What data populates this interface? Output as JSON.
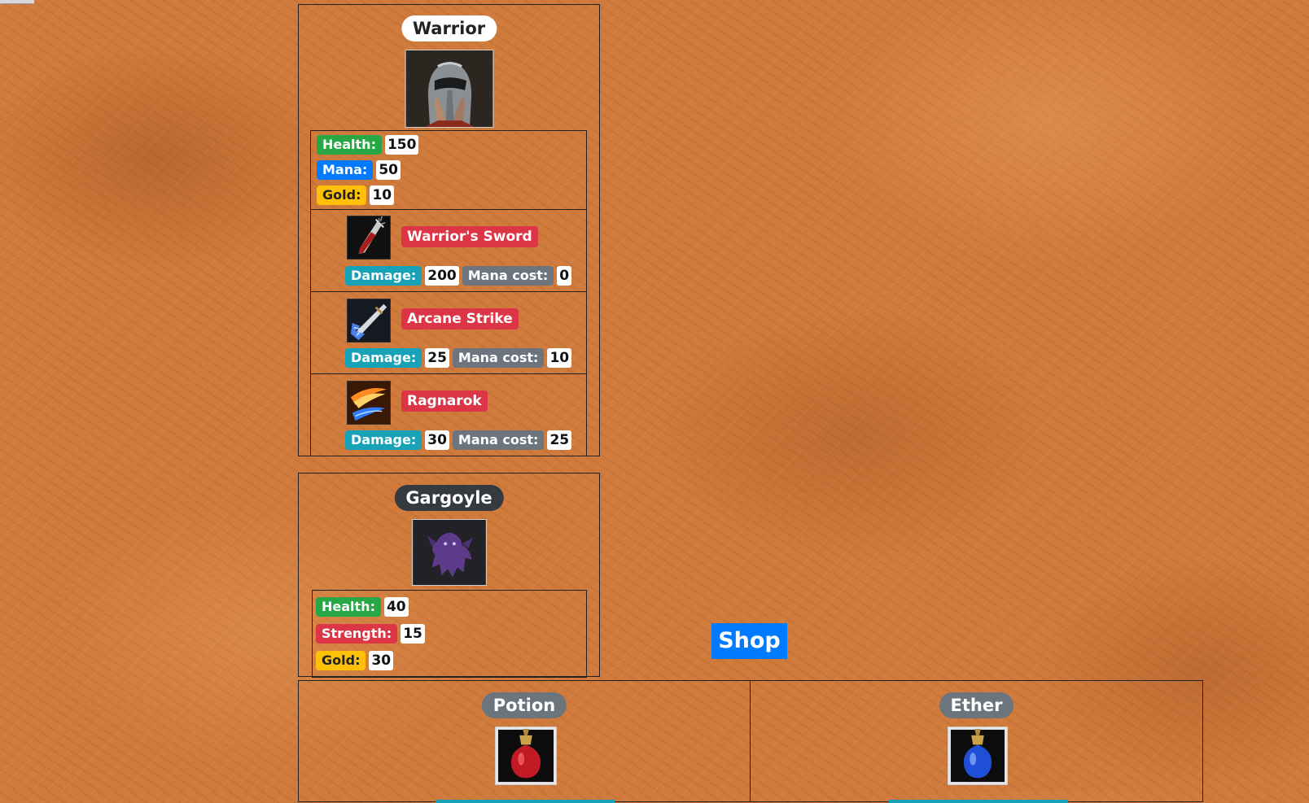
{
  "hero": {
    "name": "Warrior",
    "portrait_icon": "warrior-helmet-portrait",
    "stats": {
      "health_label": "Health:",
      "health": "150",
      "mana_label": "Mana:",
      "mana": "50",
      "gold_label": "Gold:",
      "gold": "10"
    },
    "skills": [
      {
        "name": "Warrior's Sword",
        "icon": "bloody-sword-icon",
        "damage_label": "Damage:",
        "damage": "200",
        "mana_cost_label": "Mana cost:",
        "mana_cost": "0"
      },
      {
        "name": "Arcane Strike",
        "icon": "lightning-blade-icon",
        "damage_label": "Damage:",
        "damage": "25",
        "mana_cost_label": "Mana cost:",
        "mana_cost": "10"
      },
      {
        "name": "Ragnarok",
        "icon": "fire-ice-slash-icon",
        "damage_label": "Damage:",
        "damage": "30",
        "mana_cost_label": "Mana cost:",
        "mana_cost": "25"
      }
    ]
  },
  "enemy": {
    "name": "Gargoyle",
    "portrait_icon": "gargoyle-portrait",
    "stats": {
      "health_label": "Health:",
      "health": "40",
      "strength_label": "Strength:",
      "strength": "15",
      "gold_label": "Gold:",
      "gold": "30"
    }
  },
  "shop": {
    "button_label": "Shop",
    "items": [
      {
        "name": "Potion",
        "icon": "red-potion-icon"
      },
      {
        "name": "Ether",
        "icon": "blue-ether-icon"
      }
    ]
  },
  "colors": {
    "background": "#d07a3c",
    "health": "#28a745",
    "mana": "#007bff",
    "gold": "#ffc107",
    "skill": "#dc3545",
    "damage": "#17a2b8",
    "mana_cost": "#6c757d"
  }
}
